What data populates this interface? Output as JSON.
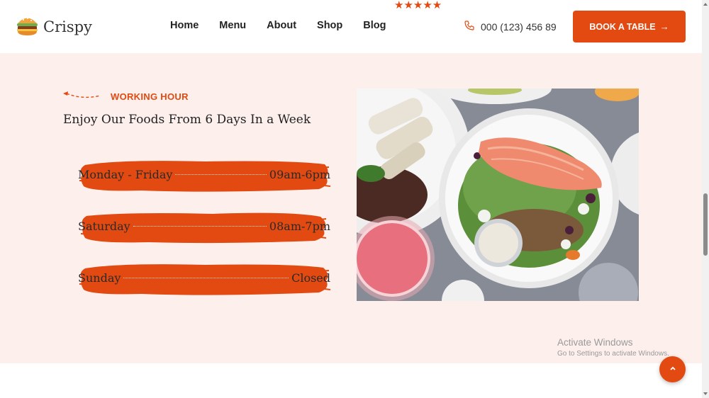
{
  "header": {
    "brand": "Crispy",
    "logo_icon": "burger-icon",
    "nav": [
      "Home",
      "Menu",
      "About",
      "Shop",
      "Blog"
    ],
    "rating_stars": "★★★★★",
    "phone": "000 (123) 456 89",
    "phone_icon": "phone-icon",
    "book_label": "BOOK A TABLE",
    "book_arrow": "→"
  },
  "section": {
    "eyebrow": "WORKING HOUR",
    "heading": "Enjoy Our Foods From 6 Days In a Week",
    "hours": [
      {
        "day": "Monday - Friday",
        "time": "09am-6pm"
      },
      {
        "day": "Saturday",
        "time": "08am-7pm"
      },
      {
        "day": "Sunday",
        "time": "Closed"
      }
    ],
    "image_alt": "salad-plate-photo"
  },
  "watermark": {
    "title": "Activate Windows",
    "subtitle": "Go to Settings to activate Windows."
  },
  "colors": {
    "accent": "#e24a12",
    "section_bg": "#fcefec"
  }
}
